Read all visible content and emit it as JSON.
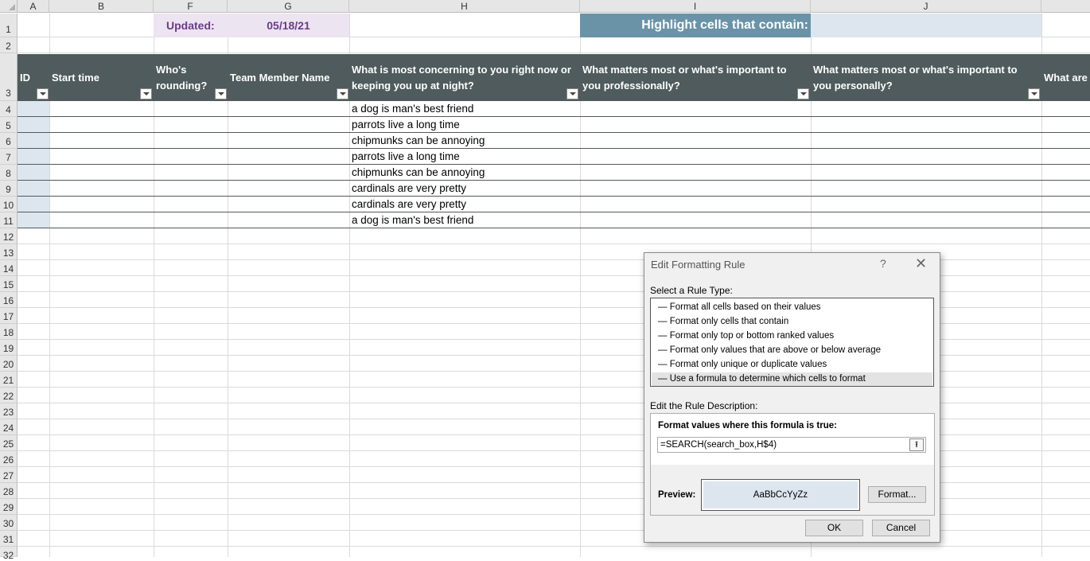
{
  "columns": [
    "A",
    "B",
    "F",
    "G",
    "H",
    "I",
    "J"
  ],
  "rows": [
    "1",
    "2",
    "3",
    "4",
    "5",
    "6",
    "7",
    "8",
    "9",
    "10",
    "11",
    "12",
    "13",
    "14",
    "15",
    "16",
    "17",
    "18",
    "19",
    "20",
    "21",
    "22",
    "23",
    "24",
    "25",
    "26",
    "27",
    "28",
    "29",
    "30",
    "31",
    "32"
  ],
  "row1": {
    "updated_label": "Updated:",
    "updated_value": "05/18/21",
    "highlight_label": "Highlight cells that contain:",
    "highlight_value": ""
  },
  "headers": {
    "id": "ID",
    "start_time": "Start time",
    "whos_rounding": "Who's rounding?",
    "team_member": "Team Member Name",
    "concerning": "What is most concerning to you right now or keeping you up at night?",
    "professional": "What matters most or what's important to you professionally?",
    "personal": "What matters most or what's important to you personally?",
    "what_are": "What are"
  },
  "h_values": [
    "a dog is man's best friend",
    "parrots live a long time",
    "chipmunks can be annoying",
    "parrots live a long time",
    "chipmunks can be annoying",
    "cardinals are very pretty",
    "cardinals are very pretty",
    "a dog is man's best friend"
  ],
  "dialog": {
    "title": "Edit Formatting Rule",
    "help": "?",
    "close": "✕",
    "select_label": "Select a Rule Type:",
    "rule_types": [
      "Format all cells based on their values",
      "Format only cells that contain",
      "Format only top or bottom ranked values",
      "Format only values that are above or below average",
      "Format only unique or duplicate values",
      "Use a formula to determine which cells to format"
    ],
    "selected_rule_index": 5,
    "edit_label": "Edit the Rule Description:",
    "formula_label": "Format values where this formula is true:",
    "formula_value": "=SEARCH(search_box,H$4)",
    "preview_label": "Preview:",
    "preview_sample": "AaBbCcYyZz",
    "format_button": "Format...",
    "ok_button": "OK",
    "cancel_button": "Cancel"
  },
  "colors": {
    "header_band": "#4f5b5c",
    "row1_highlight": "#6a93a8",
    "updated_fill": "#ece4f0",
    "updated_text": "#6b3a8c",
    "id_fill": "#dde6ee",
    "preview_fill": "#dde6ee"
  }
}
